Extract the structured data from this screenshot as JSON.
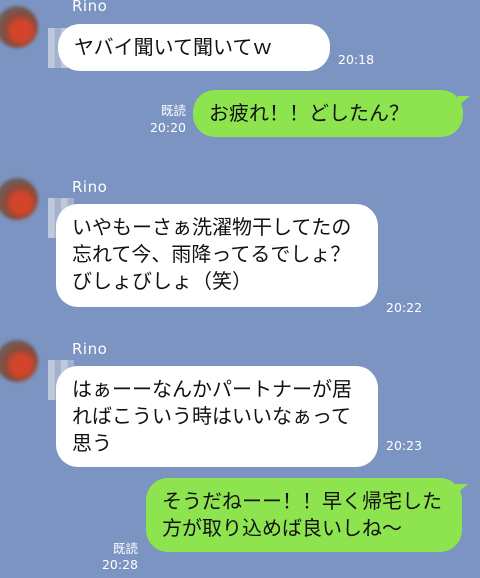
{
  "chat": {
    "sender_name": "Rino",
    "messages": [
      {
        "direction": "in",
        "text": "ヤバイ聞いて聞いてｗ",
        "time": "20:18"
      },
      {
        "direction": "out",
        "text": "お疲れ！！どしたん？",
        "read": "既読",
        "time": "20:20"
      },
      {
        "direction": "in",
        "text": "いやもーさぁ洗濯物干してたの忘れて今、雨降ってるでしょ？びしょびしょ（笑）",
        "time": "20:22"
      },
      {
        "direction": "in",
        "text": "はぁーーなんかパートナーが居ればこういう時はいいなぁって思う",
        "time": "20:23"
      },
      {
        "direction": "out",
        "text": "そうだねーー！！早く帰宅した方が取り込めば良いしね〜",
        "read": "既読",
        "time": "20:28"
      }
    ]
  },
  "colors": {
    "background": "#7b94c1",
    "incoming_bubble": "#ffffff",
    "outgoing_bubble": "#8ee44f",
    "meta_text": "#ffffff"
  }
}
